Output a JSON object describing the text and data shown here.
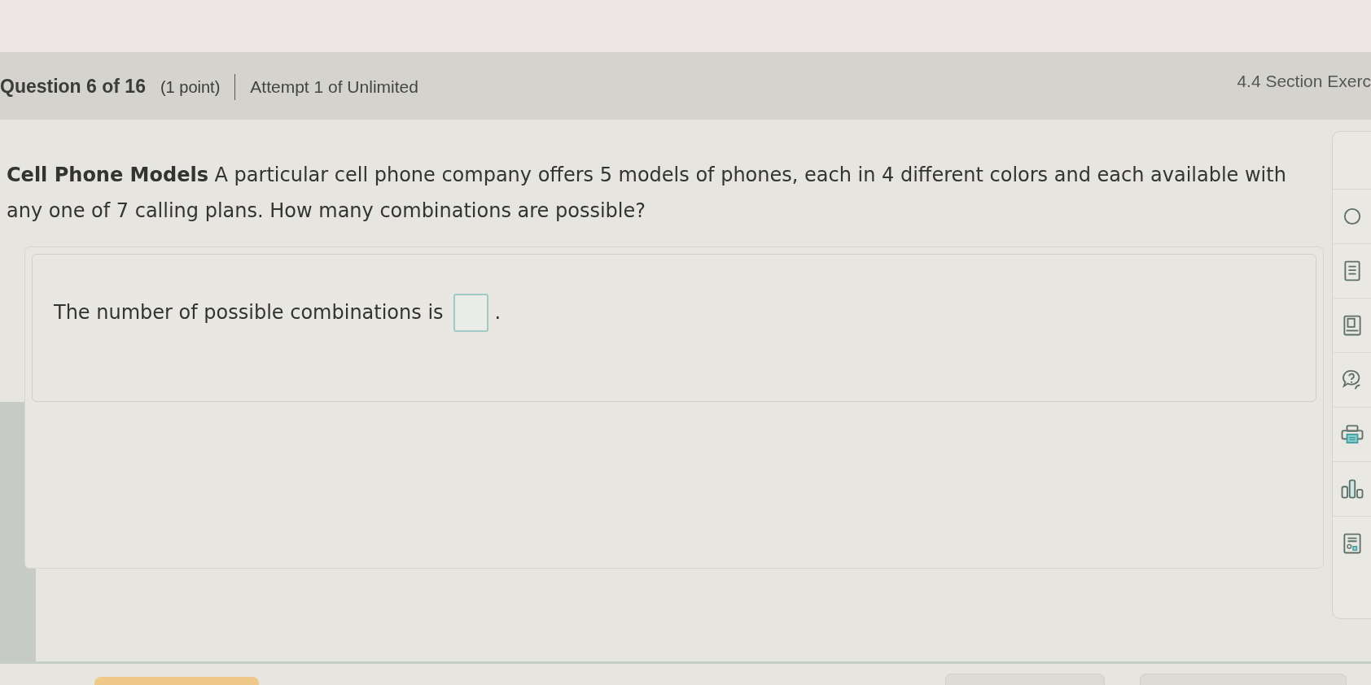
{
  "header": {
    "question_number": "Question 6 of 16",
    "points": "(1 point)",
    "attempt": "Attempt 1 of Unlimited",
    "section": "4.4 Section Exerc"
  },
  "question": {
    "text": "**Cell Phone Models** A particular cell phone company offers 5 models of phones, each in 4 different colors and each available with any one of 7 calling plans. How many combinations are possible?"
  },
  "answer": {
    "prompt": "The number of possible combinations is",
    "suffix": "."
  }
}
